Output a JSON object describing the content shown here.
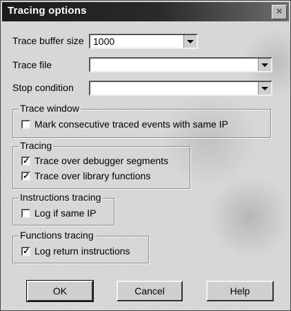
{
  "window": {
    "title": "Tracing options",
    "close_glyph": "×"
  },
  "fields": {
    "buffer_label": "Trace buffer size",
    "buffer_value": "1000",
    "file_label": "Trace file",
    "file_value": "",
    "stop_label": "Stop condition",
    "stop_value": ""
  },
  "groups": {
    "trace_window": {
      "title": "Trace window",
      "items": [
        {
          "label": "Mark consecutive traced events with same IP",
          "checked": false
        }
      ]
    },
    "tracing": {
      "title": "Tracing",
      "items": [
        {
          "label": "Trace over debugger segments",
          "checked": true
        },
        {
          "label": "Trace over library functions",
          "checked": true
        }
      ]
    },
    "instructions_tracing": {
      "title": "Instructions tracing",
      "items": [
        {
          "label": "Log if same IP",
          "checked": false
        }
      ]
    },
    "functions_tracing": {
      "title": "Functions tracing",
      "items": [
        {
          "label": "Log return instructions",
          "checked": true
        }
      ]
    }
  },
  "buttons": {
    "ok": "OK",
    "cancel": "Cancel",
    "help": "Help"
  }
}
